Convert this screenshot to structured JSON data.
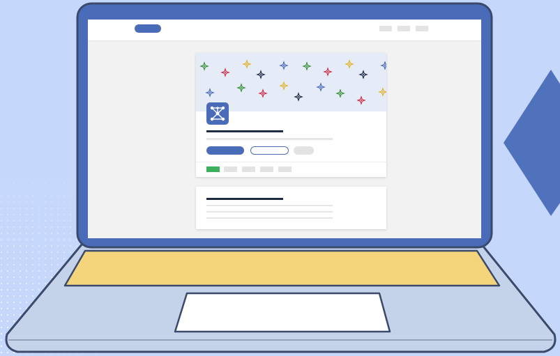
{
  "illustration": {
    "description_type": "laptop-web-page-illustration",
    "colors": {
      "background": "#c5d7fb",
      "laptop_frame": "#4a6cb8",
      "laptop_base": "#c5d3ea",
      "laptop_outline": "#3b4a6b",
      "keyboard": "#f5d57c",
      "trackpad": "#ffffff",
      "screen_bg": "#f2f2f2",
      "header_bar": "#ffffff",
      "accent": "#4a6cb8",
      "dark_text_line": "#1d2a44",
      "light_line": "#e3e3e3",
      "green_indicator": "#3bb15b",
      "cover_bg": "#e5ebf7",
      "decor_diamond": "#4a6cb8"
    },
    "sparkle_colors": [
      "#3a8f3a",
      "#c8324b",
      "#e2b32a",
      "#1d2a44",
      "#4a6cb8"
    ],
    "icons": {
      "app_logo": "network-nodes-icon",
      "pattern": "sparkle-icon"
    }
  }
}
